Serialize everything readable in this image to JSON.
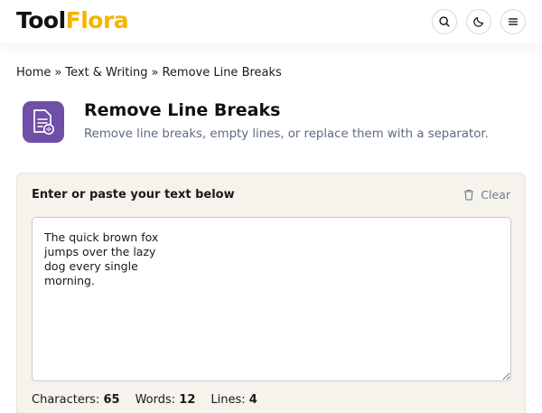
{
  "header": {
    "logo_part1": "Tool",
    "logo_part2": "Flora",
    "logo_colors": {
      "part1": "#111111",
      "part2": "#f5b400"
    },
    "icons": [
      "search-icon",
      "moon-icon",
      "menu-icon"
    ]
  },
  "breadcrumb": {
    "items": [
      "Home",
      "Text & Writing",
      "Remove Line Breaks"
    ],
    "separator": "»"
  },
  "tool": {
    "title": "Remove Line Breaks",
    "subtitle": "Remove line breaks, empty lines, or replace them with a separator.",
    "icon": "document-icon",
    "icon_bg": "#6f4fa8"
  },
  "editor": {
    "label": "Enter or paste your text below",
    "clear_label": "Clear",
    "text": "The quick brown fox\njumps over the lazy\ndog every single\nmorning.",
    "stats": {
      "characters_label": "Characters:",
      "characters": "65",
      "words_label": "Words:",
      "words": "12",
      "lines_label": "Lines:",
      "lines": "4"
    }
  }
}
